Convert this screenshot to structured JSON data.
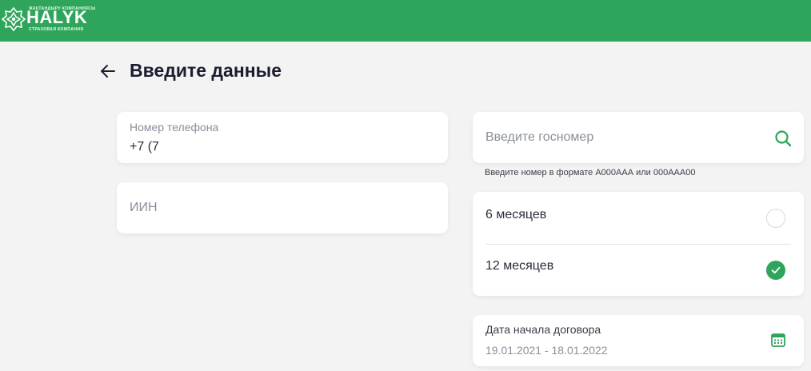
{
  "header": {
    "brand_name": "HALYK",
    "brand_top": "ЖАҚТАНДЫРУ КОМПАНИЯСЫ",
    "brand_sub": "СТРАХОВАЯ КОМПАНИЯ",
    "background_color": "#2ea55a"
  },
  "page": {
    "title": "Введите данные",
    "back_icon": "arrow-left-icon"
  },
  "phone": {
    "label": "Номер телефона",
    "value": "+7 (7"
  },
  "iin": {
    "placeholder": "ИИН",
    "value": ""
  },
  "gos_number": {
    "placeholder": "Введите госномер",
    "value": "",
    "icon": "search-icon",
    "hint": "Введите номер в формате А000ААА или 000ААА00"
  },
  "period": {
    "options": [
      {
        "label": "6 месяцев",
        "selected": false
      },
      {
        "label": "12 месяцев",
        "selected": true
      }
    ]
  },
  "contract_date": {
    "label": "Дата начала договора",
    "value": "19.01.2021 - 18.01.2022",
    "icon": "calendar-icon"
  },
  "colors": {
    "accent": "#2ea55a",
    "background": "#f3f3f3",
    "card": "#ffffff",
    "muted_text": "#8a8f99"
  }
}
